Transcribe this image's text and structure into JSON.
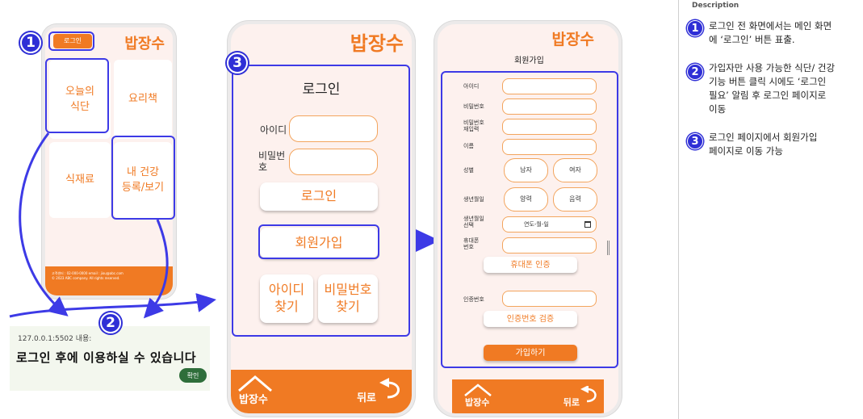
{
  "phone1": {
    "login_button": "로그인",
    "brand": "밥장수",
    "tiles": [
      {
        "label": "오늘의\n식단"
      },
      {
        "label": "요리책"
      },
      {
        "label": "식재료"
      },
      {
        "label": "내 건강\n등록/보기"
      }
    ],
    "footer_line1": "고객센터 : 02-000-0000 email : jiou@abc.com",
    "footer_line2": "© 2023 ABC company. All rights reserved."
  },
  "alert": {
    "origin": "127.0.0.1:5502 내용:",
    "message": "로그인 후에 이용하실 수 있습니다",
    "confirm": "확인"
  },
  "phone2": {
    "brand": "밥장수",
    "title": "로그인",
    "id_label": "아이디",
    "pw_label": "비밀번\n호",
    "login_button": "로그인",
    "signup_button": "회원가입",
    "find_id": "아이디\n찾기",
    "find_pw": "비밀번호\n찾기",
    "footer_logo": "밥장수",
    "footer_back": "뒤로"
  },
  "phone3": {
    "brand": "밥장수",
    "title": "회원가입",
    "labels": {
      "id": "아이디",
      "pw": "비밀번호",
      "pw_confirm": "비밀번호\n재입력",
      "name": "이름",
      "gender": "성별",
      "birth": "생년월일",
      "birth_select": "생년월일\n선택",
      "phone": "휴대폰\n번호",
      "code": "인증번호"
    },
    "gender_options": [
      "남자",
      "여자"
    ],
    "calendar_options": [
      "양력",
      "음력"
    ],
    "date_placeholder": "연도-월-일",
    "phone_verify": "휴대폰 인증",
    "code_verify": "인증번호 검증",
    "submit": "가입하기",
    "footer_logo": "밥장수",
    "footer_back": "뒤로"
  },
  "description": {
    "header": "Description",
    "items": [
      {
        "num": "1",
        "text": "로그인 전 화면에서는 메인 화면\n에 ‘로그인’ 버튼 표출."
      },
      {
        "num": "2",
        "text": "가입자만 사용 가능한 식단/ 건강\n기능 버튼 클릭 시에도 ‘로그인\n필요’ 알림 후 로그인  페이지로\n이동"
      },
      {
        "num": "3",
        "text": "로그인 페이지에서 회원가입\n페이지로 이동 가능"
      }
    ]
  },
  "step_badges": [
    "1",
    "2",
    "3"
  ],
  "colors": {
    "accent": "#f07a23",
    "highlight": "#3d3ae6",
    "badge": "#2f2fd6",
    "screen": "#fdf1ee"
  }
}
